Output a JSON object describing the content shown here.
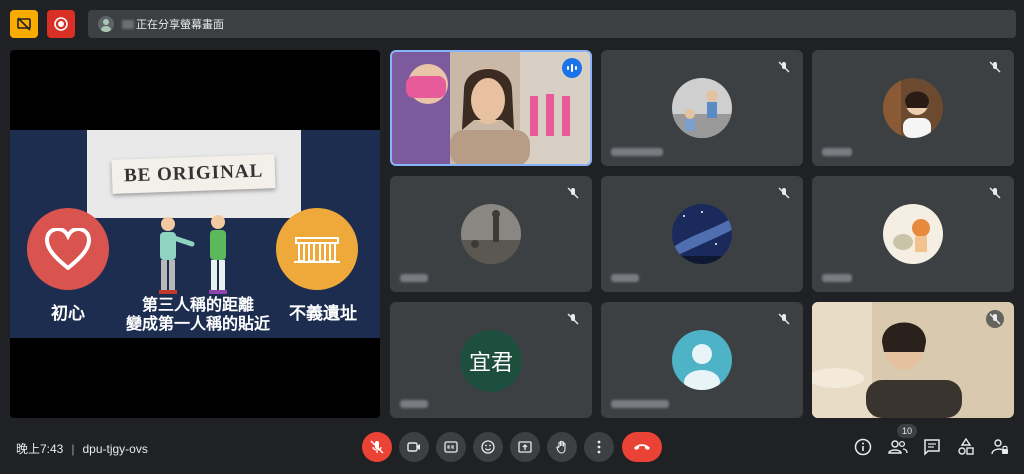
{
  "top": {
    "share_status": "正在分享螢幕畫面"
  },
  "slide": {
    "paper_text": "BE ORIGINAL",
    "label_left": "初心",
    "label_center_line1": "第三人稱的距離",
    "label_center_line2": "變成第一人稱的貼近",
    "label_right": "不義遺址"
  },
  "tiles": {
    "initials": "宜君"
  },
  "bottom": {
    "time": "晚上7:43",
    "separator": "|",
    "meeting_code": "dpu-tjgy-ovs",
    "participants_count": "10"
  },
  "colors": {
    "background": "#202124",
    "tile": "#3c4043",
    "end_call": "#ea4335",
    "active_border": "#8ab4f8"
  }
}
